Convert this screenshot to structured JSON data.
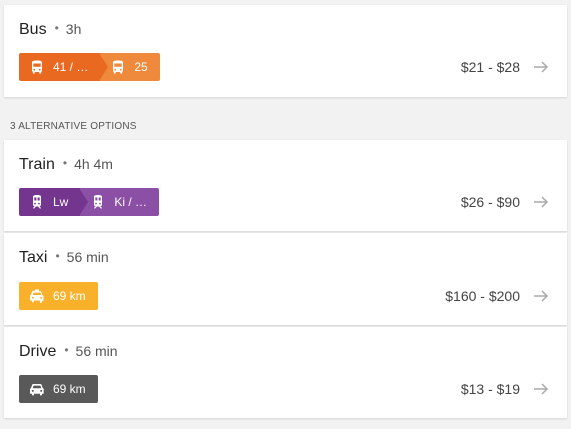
{
  "primary": {
    "mode": "Bus",
    "separator": "•",
    "duration": "3h",
    "price": "$21 - $28",
    "segments": [
      {
        "icon": "bus-icon",
        "label": "41 / …",
        "color": "#e8691f"
      },
      {
        "icon": "bus-icon",
        "label": "25",
        "color": "#ef8a3c"
      }
    ]
  },
  "alternatives_header": "3 ALTERNATIVE OPTIONS",
  "alternatives": [
    {
      "mode": "Train",
      "separator": "•",
      "duration": "4h 4m",
      "price": "$26 - $90",
      "segments": [
        {
          "icon": "train-icon",
          "label": "Lw",
          "color": "#74358f"
        },
        {
          "icon": "train-icon",
          "label": "Ki / …",
          "color": "#8b50a6"
        }
      ]
    },
    {
      "mode": "Taxi",
      "separator": "•",
      "duration": "56 min",
      "price": "$160 - $200",
      "segments": [
        {
          "icon": "taxi-icon",
          "label": "69 km",
          "color": "#f9b12c"
        }
      ]
    },
    {
      "mode": "Drive",
      "separator": "•",
      "duration": "56 min",
      "price": "$13 - $19",
      "segments": [
        {
          "icon": "car-icon",
          "label": "69 km",
          "color": "#595959"
        }
      ]
    }
  ]
}
